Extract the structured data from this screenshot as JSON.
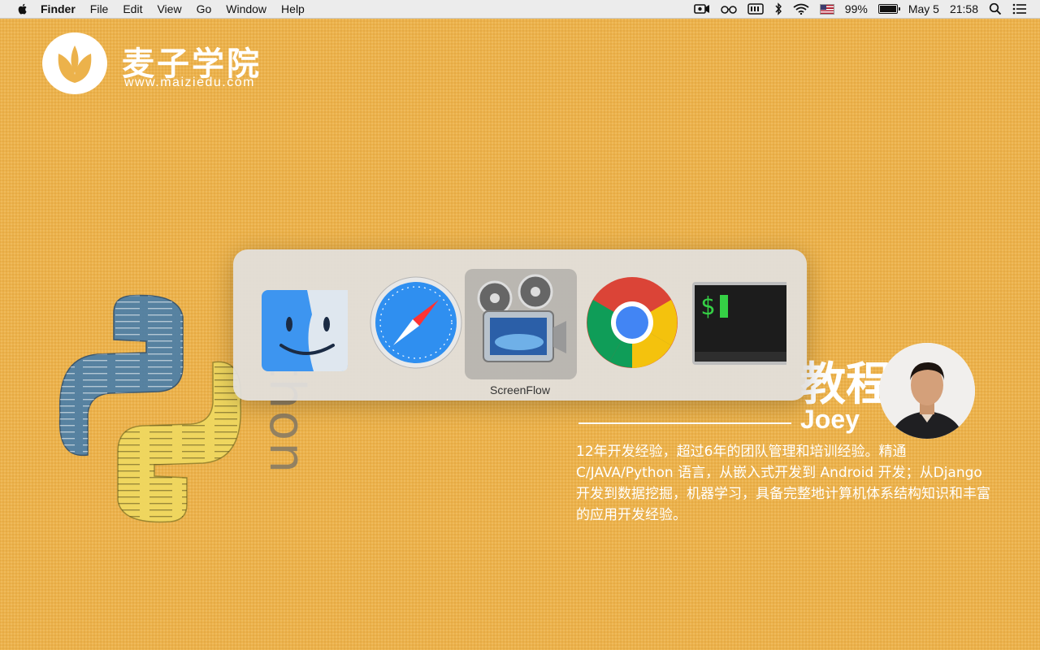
{
  "menubar": {
    "app_name": "Finder",
    "items": [
      "File",
      "Edit",
      "View",
      "Go",
      "Window",
      "Help"
    ],
    "battery_percent": "99%",
    "date": "May 5",
    "time": "21:58"
  },
  "brand": {
    "name": "麦子学院",
    "url": "www.maiziedu.com"
  },
  "decor": {
    "python_word": "thon"
  },
  "course": {
    "title_fragment": "教程",
    "instructor": "Joey",
    "bio": "12年开发经验，超过6年的团队管理和培训经验。精通C/JAVA/Python 语言，从嵌入式开发到 Android 开发；从Django 开发到数据挖掘，机器学习，具备完整地计算机体系结构知识和丰富的应用开发经验。"
  },
  "app_switcher": {
    "apps": [
      {
        "name": "finder-icon"
      },
      {
        "name": "safari-icon"
      },
      {
        "name": "screenflow-icon"
      },
      {
        "name": "chrome-icon"
      },
      {
        "name": "terminal-icon"
      }
    ],
    "selected_label": "ScreenFlow"
  },
  "colors": {
    "background": "#ecb24b",
    "menubar": "#ececec",
    "switcher": "#e2e0de"
  }
}
